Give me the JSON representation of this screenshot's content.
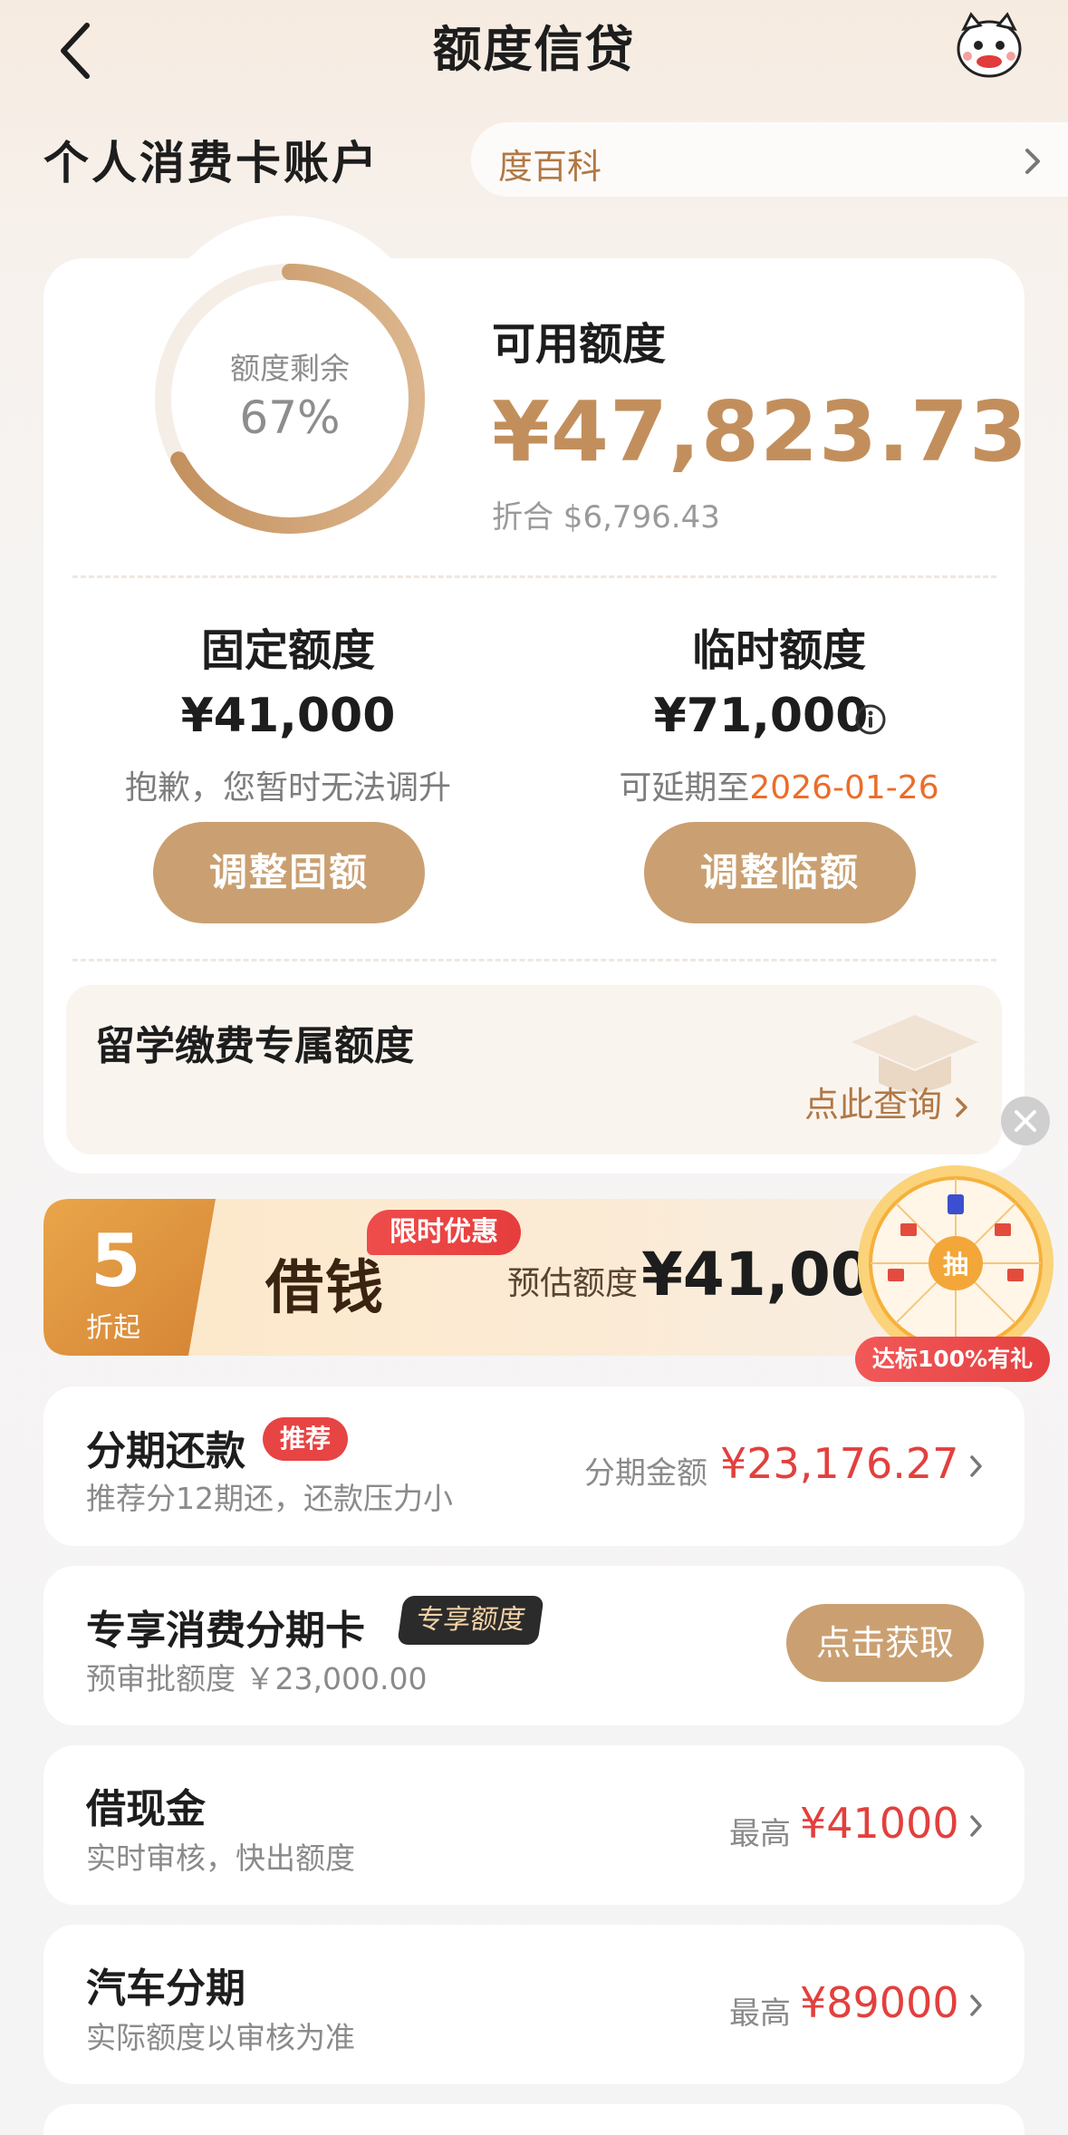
{
  "header": {
    "title": "额度信贷"
  },
  "account": {
    "title": "个人消费卡账户",
    "wiki_label": "度百科"
  },
  "credit": {
    "ring_label": "额度剩余",
    "ring_percent": "67%",
    "ring_fraction": 0.67,
    "available_title": "可用额度",
    "available_amount": "¥47,823.73",
    "converted": "折合 $6,796.43"
  },
  "fixed": {
    "title": "固定额度",
    "amount": "¥41,000",
    "note": "抱歉，您暂时无法调升",
    "button": "调整固额"
  },
  "temporary": {
    "title": "临时额度",
    "amount": "¥71,000",
    "note_prefix": "可延期至",
    "note_date": "2026-01-26",
    "button": "调整临额"
  },
  "study": {
    "title": "留学缴费专属额度",
    "link": "点此查询"
  },
  "banner": {
    "discount_num": "5",
    "discount_unit": "折起",
    "title": "借钱",
    "promo_tag": "限时优惠",
    "estimate_label": "预估额度",
    "estimate_amount": "¥41,000",
    "wheel_center": "抽",
    "wheel_tag": "达标100%有礼"
  },
  "items": [
    {
      "title": "分期还款",
      "tag": "推荐",
      "subtitle": "推荐分12期还，还款压力小",
      "right_label": "分期金额",
      "right_amount": "¥23,176.27"
    },
    {
      "title": "专享消费分期卡",
      "tag": "专享额度",
      "subtitle": "预审批额度 ￥23,000.00",
      "button": "点击获取"
    },
    {
      "title": "借现金",
      "subtitle": "实时审核，快出额度",
      "right_label": "最高",
      "right_amount": "¥41000"
    },
    {
      "title": "汽车分期",
      "subtitle": "实际额度以审核为准",
      "right_label": "最高",
      "right_amount": "¥89000"
    }
  ],
  "colors": {
    "accent": "#c28f5c",
    "button": "#caa072",
    "red": "#e2403e",
    "highlight": "#ec6c2a"
  }
}
